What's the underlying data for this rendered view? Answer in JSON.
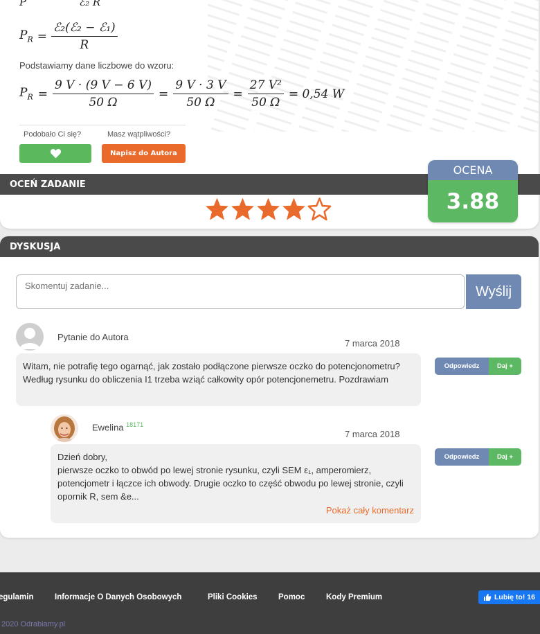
{
  "solution": {
    "formula_top_partial": "ℰ₂ R",
    "pr_symbol": "P",
    "pr_sub": "R",
    "eq1_num": "ℰ₂(ℰ₂ − ℰ₁)",
    "eq1_den": "R",
    "intro_text": "Podstawiamy dane liczbowe do wzoru:",
    "eq2_num1": "9 V · (9 V − 6 V)",
    "eq2_den1": "50 Ω",
    "eq2_num2": "9 V · 3 V",
    "eq2_den2": "50 Ω",
    "eq2_num3": "27 V²",
    "eq2_den3": "50 Ω",
    "eq2_result": "= 0,54 W"
  },
  "feedback": {
    "like_label": "Podobało Ci się?",
    "doubt_label": "Masz wątpliwości?",
    "author_button": "Napisz do Autora",
    "heart_icon": "heart-icon"
  },
  "rate": {
    "section_title": "OCEŃ ZADANIE",
    "rating_heading": "OCENA",
    "rating_value": "3.88",
    "stars_filled": 4,
    "stars_total": 5,
    "star_color": "#ea6a2b"
  },
  "discussion": {
    "section_title": "DYSKUSJA",
    "comment_placeholder": "Skomentuj zadanie...",
    "send_label": "Wyślij",
    "comments": [
      {
        "author": "Pytanie do Autora",
        "date": "7 marca 2018",
        "text": "Witam, nie potrafię tego ogarnąć, jak zostało podłączone pierwsze oczko do potencjonometru? Według rysunku do obliczenia I1 trzeba wziąć całkowity opór potencjonemetru. Pozdrawiam",
        "reply_label": "Odpowiedz",
        "give_label": "Daj +"
      },
      {
        "author": "Ewelina",
        "points": "18171",
        "date": "7 marca 2018",
        "line1": "Dzień dobry,",
        "line2": "pierwsze oczko to obwód po lewej stronie rysunku, czyli SEM ε₁, amperomierz, potencjometr i łączce ich obwody. Drugie oczko to część obwodu po lewej stronie, czyli opornik R, sem &e...",
        "show_more": "Pokaż cały komentarz",
        "reply_label": "Odpowiedz",
        "give_label": "Daj +"
      }
    ]
  },
  "footer": {
    "links": [
      "egulamin",
      "Informacje O Danych Osobowych",
      "Pliki Cookies",
      "Pomoc",
      "Kody Premium"
    ],
    "fb_label": "Lubię to! 16",
    "copyright": "2020 Odrabiamy.pl"
  },
  "colors": {
    "green": "#5db863",
    "orange": "#ea6a2b",
    "blue_gray": "#7089b3",
    "dark_bar": "#4a4a4a",
    "footer_bg": "#3e3e3e"
  }
}
